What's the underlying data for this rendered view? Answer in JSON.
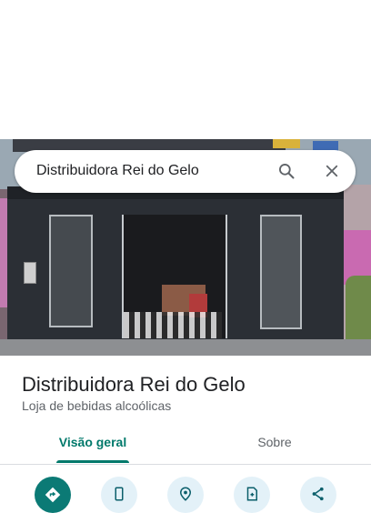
{
  "search": {
    "query": "Distribuidora Rei do Gelo",
    "search_icon": "search-icon",
    "close_icon": "close-icon"
  },
  "place": {
    "name": "Distribuidora Rei do Gelo",
    "category": "Loja de bebidas alcoólicas"
  },
  "tabs": [
    {
      "label": "Visão geral",
      "active": true
    },
    {
      "label": "Sobre",
      "active": false
    }
  ],
  "actions": [
    {
      "icon": "directions-icon"
    },
    {
      "icon": "phone-icon"
    },
    {
      "icon": "location-pin-icon"
    },
    {
      "icon": "save-icon"
    },
    {
      "icon": "share-icon"
    }
  ],
  "colors": {
    "accent": "#00796b",
    "primary_action": "#0b7a75",
    "secondary_action": "#e3f1f8",
    "title_text": "#202124",
    "secondary_text": "#5f6368"
  }
}
